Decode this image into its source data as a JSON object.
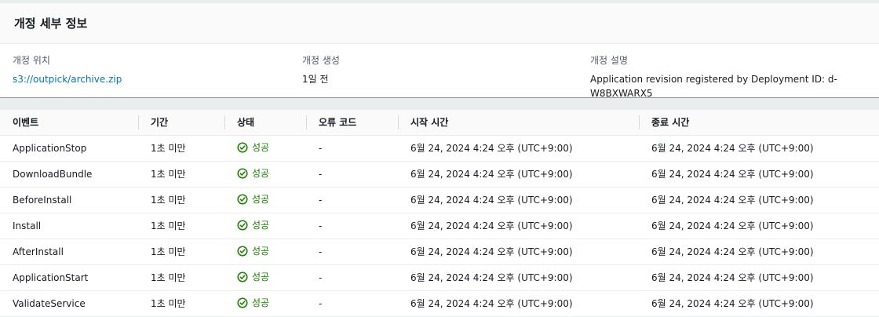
{
  "panel": {
    "title": "개정 세부 정보"
  },
  "details": {
    "location": {
      "label": "개정 위치",
      "value": "s3://outpick/archive.zip"
    },
    "created": {
      "label": "개정 생성",
      "value": "1일 전"
    },
    "description": {
      "label": "개정 설명",
      "value": "Application revision registered by Deployment ID: d-W8BXWARX5"
    }
  },
  "events_table": {
    "columns": [
      "이벤트",
      "기간",
      "상태",
      "오류 코드",
      "시작 시간",
      "종료 시간"
    ],
    "rows": [
      {
        "event": "ApplicationStop",
        "duration": "1초 미만",
        "status": "성공",
        "error": "-",
        "start": "6월 24, 2024 4:24 오후 (UTC+9:00)",
        "end": "6월 24, 2024 4:24 오후 (UTC+9:00)"
      },
      {
        "event": "DownloadBundle",
        "duration": "1초 미만",
        "status": "성공",
        "error": "-",
        "start": "6월 24, 2024 4:24 오후 (UTC+9:00)",
        "end": "6월 24, 2024 4:24 오후 (UTC+9:00)"
      },
      {
        "event": "BeforeInstall",
        "duration": "1초 미만",
        "status": "성공",
        "error": "-",
        "start": "6월 24, 2024 4:24 오후 (UTC+9:00)",
        "end": "6월 24, 2024 4:24 오후 (UTC+9:00)"
      },
      {
        "event": "Install",
        "duration": "1초 미만",
        "status": "성공",
        "error": "-",
        "start": "6월 24, 2024 4:24 오후 (UTC+9:00)",
        "end": "6월 24, 2024 4:24 오후 (UTC+9:00)"
      },
      {
        "event": "AfterInstall",
        "duration": "1초 미만",
        "status": "성공",
        "error": "-",
        "start": "6월 24, 2024 4:24 오후 (UTC+9:00)",
        "end": "6월 24, 2024 4:24 오후 (UTC+9:00)"
      },
      {
        "event": "ApplicationStart",
        "duration": "1초 미만",
        "status": "성공",
        "error": "-",
        "start": "6월 24, 2024 4:24 오후 (UTC+9:00)",
        "end": "6월 24, 2024 4:24 오후 (UTC+9:00)"
      },
      {
        "event": "ValidateService",
        "duration": "1초 미만",
        "status": "성공",
        "error": "-",
        "start": "6월 24, 2024 4:24 오후 (UTC+9:00)",
        "end": "6월 24, 2024 4:24 오후 (UTC+9:00)"
      }
    ]
  },
  "colors": {
    "link": "#0073bb",
    "success": "#1d8102",
    "header_bg": "#fafafa"
  },
  "icons": {
    "status_success": "check-circle-icon"
  }
}
